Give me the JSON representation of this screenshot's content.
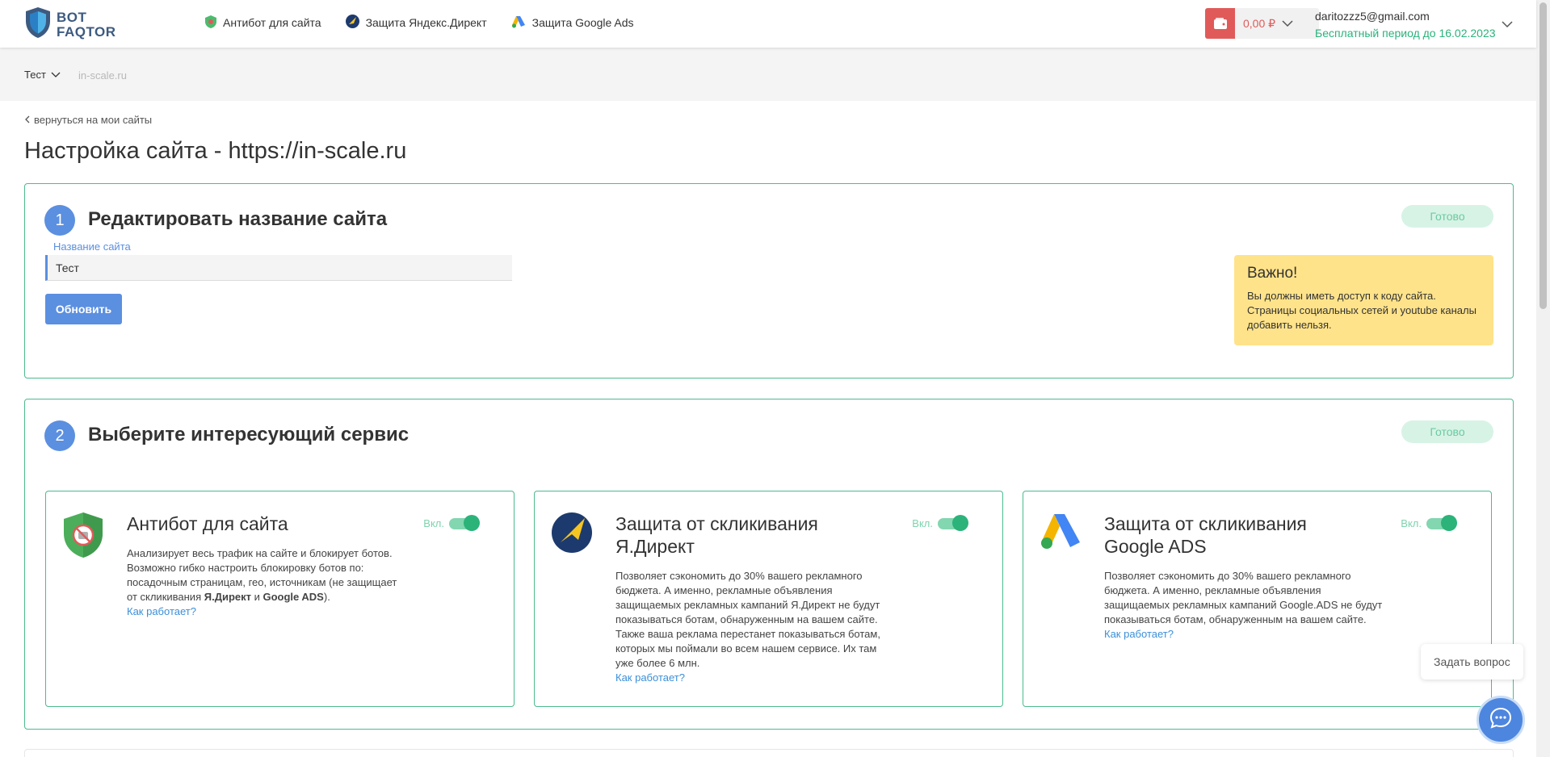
{
  "header": {
    "logo_line1": "BOT",
    "logo_line2": "FAQTOR",
    "nav": [
      {
        "label": "Антибот для сайта",
        "icon": "shield-icon"
      },
      {
        "label": "Защита Яндекс.Директ",
        "icon": "yandex-direct-icon"
      },
      {
        "label": "Защита Google Ads",
        "icon": "google-ads-icon"
      }
    ],
    "balance": "0,00 ₽",
    "email": "daritozzz5@gmail.com",
    "trial": "Бесплатный период до 16.02.2023"
  },
  "subbar": {
    "site_name": "Тест",
    "domain": "in-scale.ru"
  },
  "back_link": "вернуться на мои сайты",
  "page_title": "Настройка сайта - https://in-scale.ru",
  "section1": {
    "number": "1",
    "title": "Редактировать название сайта",
    "status": "Готово",
    "field_label": "Название сайта",
    "field_value": "Тест",
    "button": "Обновить",
    "note_title": "Важно!",
    "note_text": "Вы должны иметь доступ к коду сайта. Страницы социальных сетей и youtube каналы добавить нельзя."
  },
  "section2": {
    "number": "2",
    "title": "Выберите интересующий сервис",
    "status": "Готово",
    "cards": [
      {
        "title": "Антибот для сайта",
        "toggle_label": "Вкл.",
        "enabled": true,
        "desc_part1": "Анализирует весь трафик на сайте и блокирует ботов. Возможно гибко настроить блокировку ботов по: посадочным страницам, гео, источникам (не защищает от скликивания ",
        "desc_bold1": "Я.Директ",
        "desc_and": " и ",
        "desc_bold2": "Google ADS",
        "desc_end": ").",
        "link": "Как работает?"
      },
      {
        "title": "Защита от скликивания Я.Директ",
        "toggle_label": "Вкл.",
        "enabled": true,
        "desc": "Позволяет сэкономить до 30% вашего рекламного бюджета. А именно, рекламные объявления защищаемых рекламных кампаний Я.Директ не будут показываться ботам, обнаруженным на вашем сайте. Также ваша реклама перестанет показываться ботам, которых мы поймали во всем нашем сервисе. Их там уже более 6 млн.",
        "link": "Как работает?"
      },
      {
        "title": "Защита от скликивания Google ADS",
        "toggle_label": "Вкл.",
        "enabled": true,
        "desc": "Позволяет сэкономить до 30% вашего рекламного бюджета. А именно, рекламные объявления защищаемых рекламных кампаний Google.ADS не будут показываться ботам, обнаруженным на вашем сайте.",
        "link": "Как работает?"
      }
    ]
  },
  "chat": {
    "prompt": "Задать вопрос"
  },
  "colors": {
    "accent": "#5b8fe0",
    "success": "#2bb37a",
    "border": "#4cbb8e",
    "danger": "#e05a5a",
    "note": "#ffe38a"
  }
}
